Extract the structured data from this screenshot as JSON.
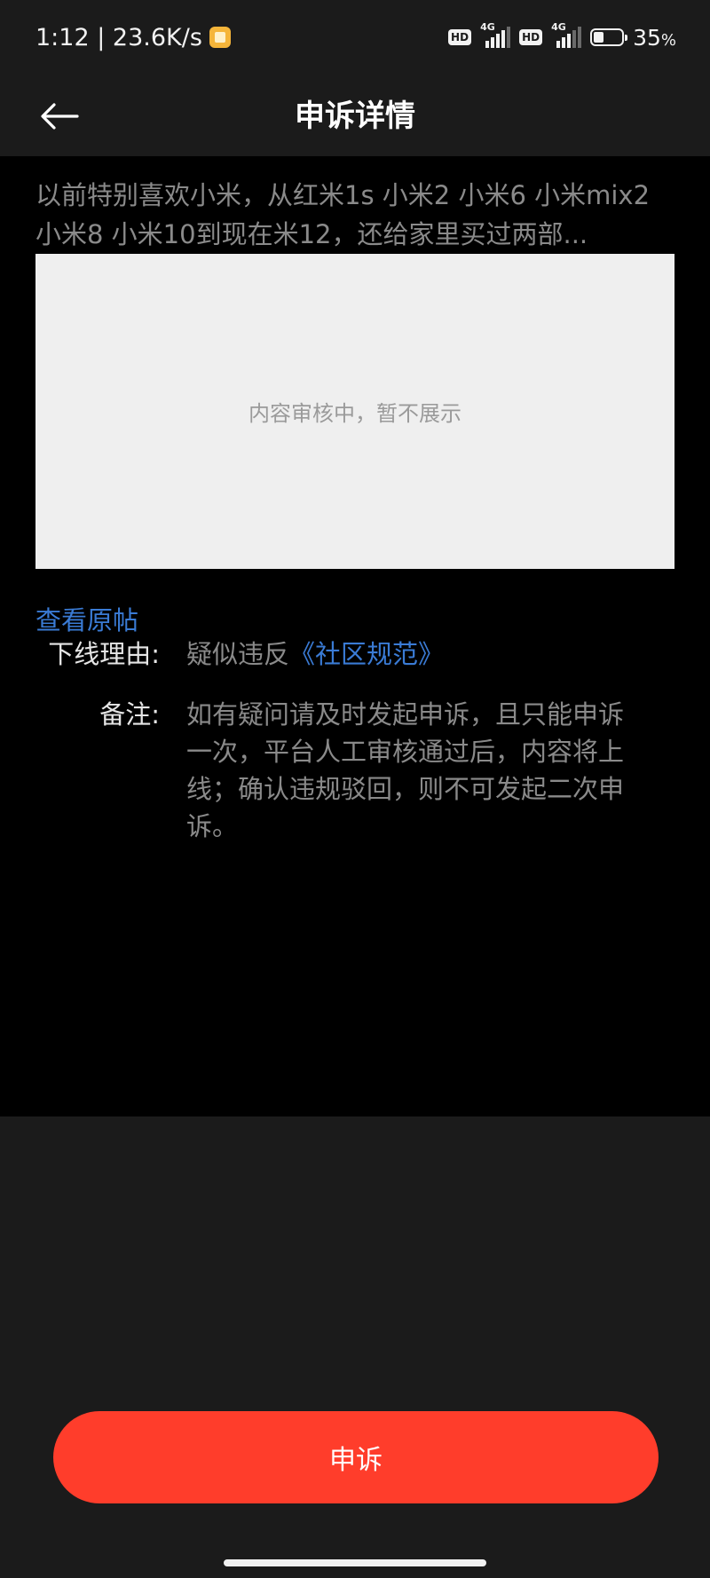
{
  "status_bar": {
    "time": "1:12",
    "network_speed": "23.6K/s",
    "sim1_hd": "HD",
    "sim1_network": "4G",
    "sim2_hd": "HD",
    "sim2_network": "4G",
    "battery_percent": "35",
    "battery_unit": "%",
    "battery_level": 0.35
  },
  "header": {
    "back_icon": "arrow-left-icon",
    "title": "申诉详情"
  },
  "post": {
    "excerpt_line1": "以前特别喜欢小米，从红米1s 小米2 小米6 小米mix2",
    "excerpt_line2": "小米8 小米10到现在米12，还给家里买过两部...",
    "review_notice": "内容审核中，暂不展示",
    "view_original_label": "查看原帖"
  },
  "details": {
    "reason_label": "下线理由:",
    "reason_prefix": "疑似违反",
    "reason_link": "《社区规范》",
    "note_label": "备注:",
    "note_text": "如有疑问请及时发起申诉，且只能申诉一次，平台人工审核通过后，内容将上线；确认违规驳回，则不可发起二次申诉。"
  },
  "actions": {
    "appeal_label": "申诉"
  },
  "colors": {
    "accent_link": "#3a7bd5",
    "appeal_button": "#ff3d2b",
    "background": "#1b1b1b",
    "content_background": "#000000"
  }
}
